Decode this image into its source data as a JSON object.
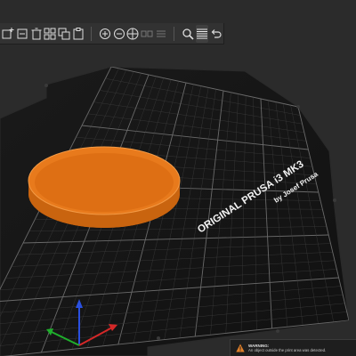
{
  "toolbar": {
    "tools": [
      {
        "name": "add-object",
        "icon": "add-object-icon"
      },
      {
        "name": "delete",
        "icon": "delete-icon"
      },
      {
        "name": "delete-all",
        "icon": "delete-all-icon"
      },
      {
        "name": "arrange",
        "icon": "arrange-icon"
      },
      {
        "name": "copy",
        "icon": "copy-icon"
      },
      {
        "name": "paste",
        "icon": "paste-icon"
      },
      {
        "name": "add-instance",
        "icon": "add-instance-icon"
      },
      {
        "name": "remove-instance",
        "icon": "remove-instance-icon"
      },
      {
        "name": "split-objects",
        "icon": "split-objects-icon"
      },
      {
        "name": "split-parts",
        "icon": "split-parts-icon"
      },
      {
        "name": "variable-layer-height",
        "icon": "layers-icon"
      },
      {
        "name": "search",
        "icon": "search-icon"
      },
      {
        "name": "layer-editing",
        "icon": "layer-editing-icon"
      },
      {
        "name": "undo",
        "icon": "undo-icon"
      }
    ]
  },
  "bed": {
    "label_line1": "ORIGINAL PRUSA i3 MK3",
    "label_line2": "by Josef Prusa"
  },
  "object": {
    "shape": "cylinder-disc",
    "color": "#e87a1c"
  },
  "colors": {
    "background": "#2b2b2b",
    "bed": "#161616",
    "grid": "#4a4a4a",
    "object": "#e87a1c",
    "warning": "#e0802a"
  },
  "warning": {
    "title": "WARNING:",
    "message": "An object outside the print area was detected."
  }
}
